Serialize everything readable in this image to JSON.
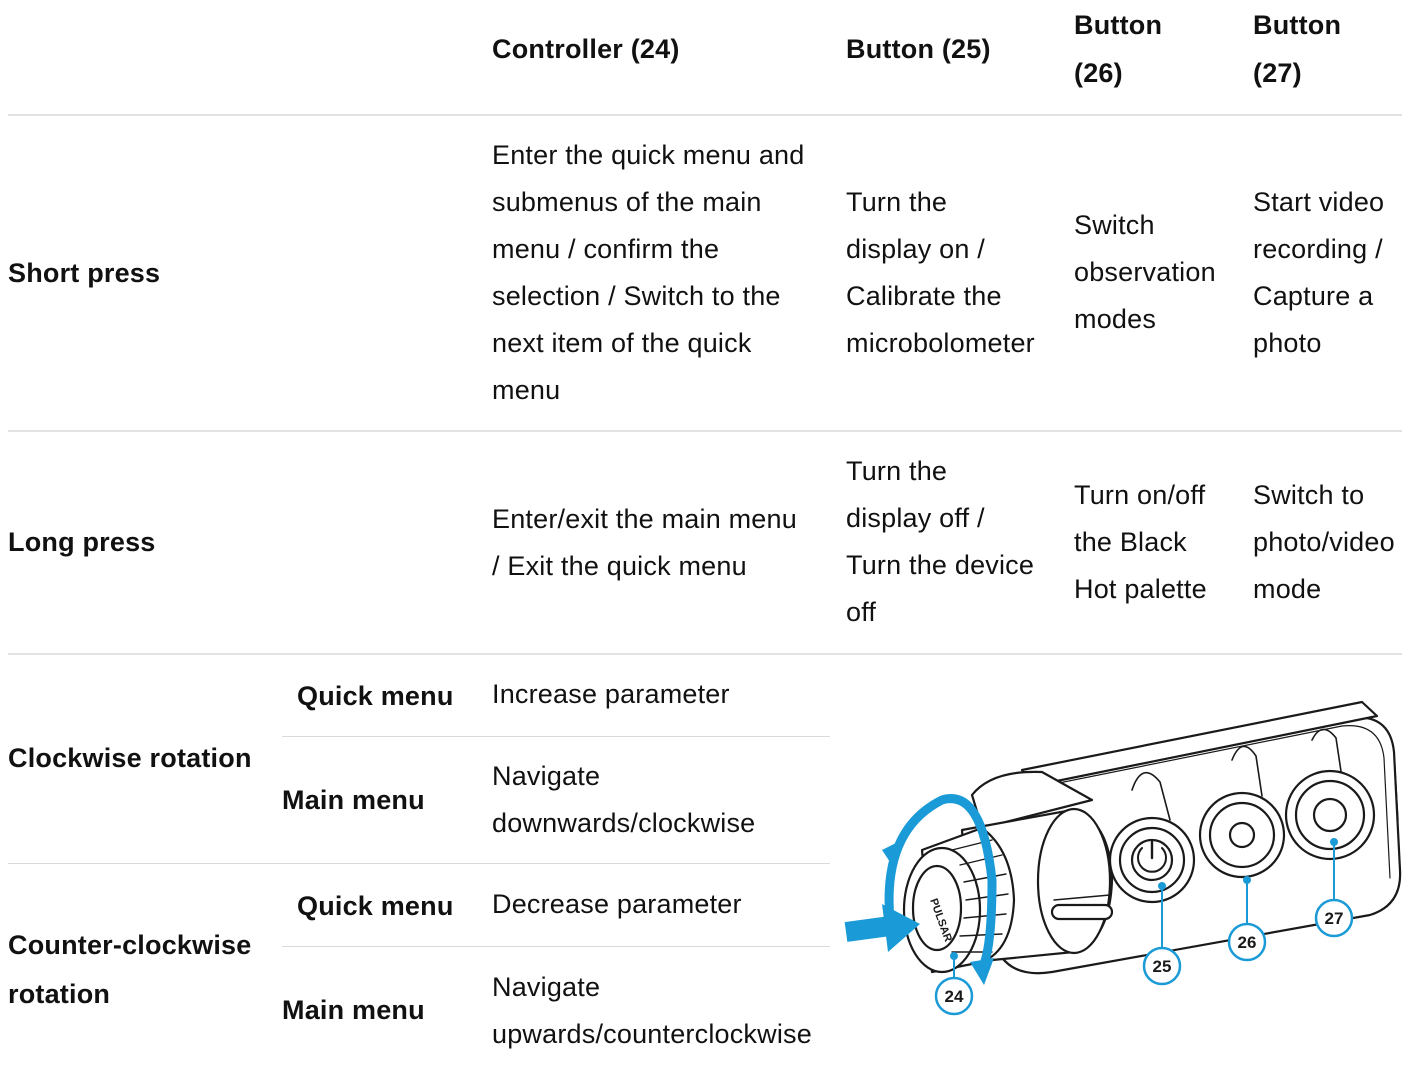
{
  "headers": {
    "col1": "Controller (24)",
    "col2": "Button (25)",
    "col3_line1": "Button",
    "col3_line2": "(26)",
    "col4_line1": "Button",
    "col4_line2": "(27)"
  },
  "rows": {
    "short_press": {
      "label": "Short press",
      "controller": [
        "Enter the quick menu and",
        "submenus of the main",
        "menu / confirm the",
        "selection / Switch to the",
        "next item of the quick",
        "menu"
      ],
      "button25": [
        "Turn the",
        "display on /",
        "Calibrate the",
        "microbolometer"
      ],
      "button26": [
        "Switch",
        "observation",
        "modes"
      ],
      "button27": [
        "Start video",
        "recording /",
        "Capture a",
        "photo"
      ]
    },
    "long_press": {
      "label": "Long press",
      "controller": [
        "Enter/exit the main menu",
        "/ Exit the quick menu"
      ],
      "button25": [
        "Turn the",
        "display off /",
        "Turn the device",
        "off"
      ],
      "button26": [
        "Turn on/off",
        "the Black",
        "Hot palette"
      ],
      "button27": [
        "Switch to",
        "photo/video",
        "mode"
      ]
    },
    "clockwise": {
      "label": "Clockwise rotation",
      "quick_label": "Quick menu",
      "quick_action": "Increase parameter",
      "main_label": "Main menu",
      "main_action": [
        "Navigate",
        "downwards/clockwise"
      ]
    },
    "counterclockwise": {
      "label": [
        "Counter-clockwise",
        "rotation"
      ],
      "quick_label": "Quick menu",
      "quick_action": "Decrease parameter",
      "main_label": "Main menu",
      "main_action": [
        "Navigate",
        "upwards/counterclockwise"
      ]
    }
  },
  "illustration": {
    "callouts": [
      "24",
      "25",
      "26",
      "27"
    ],
    "brand_mark": "PULSAR",
    "accent_color": "#1a9ad6"
  }
}
